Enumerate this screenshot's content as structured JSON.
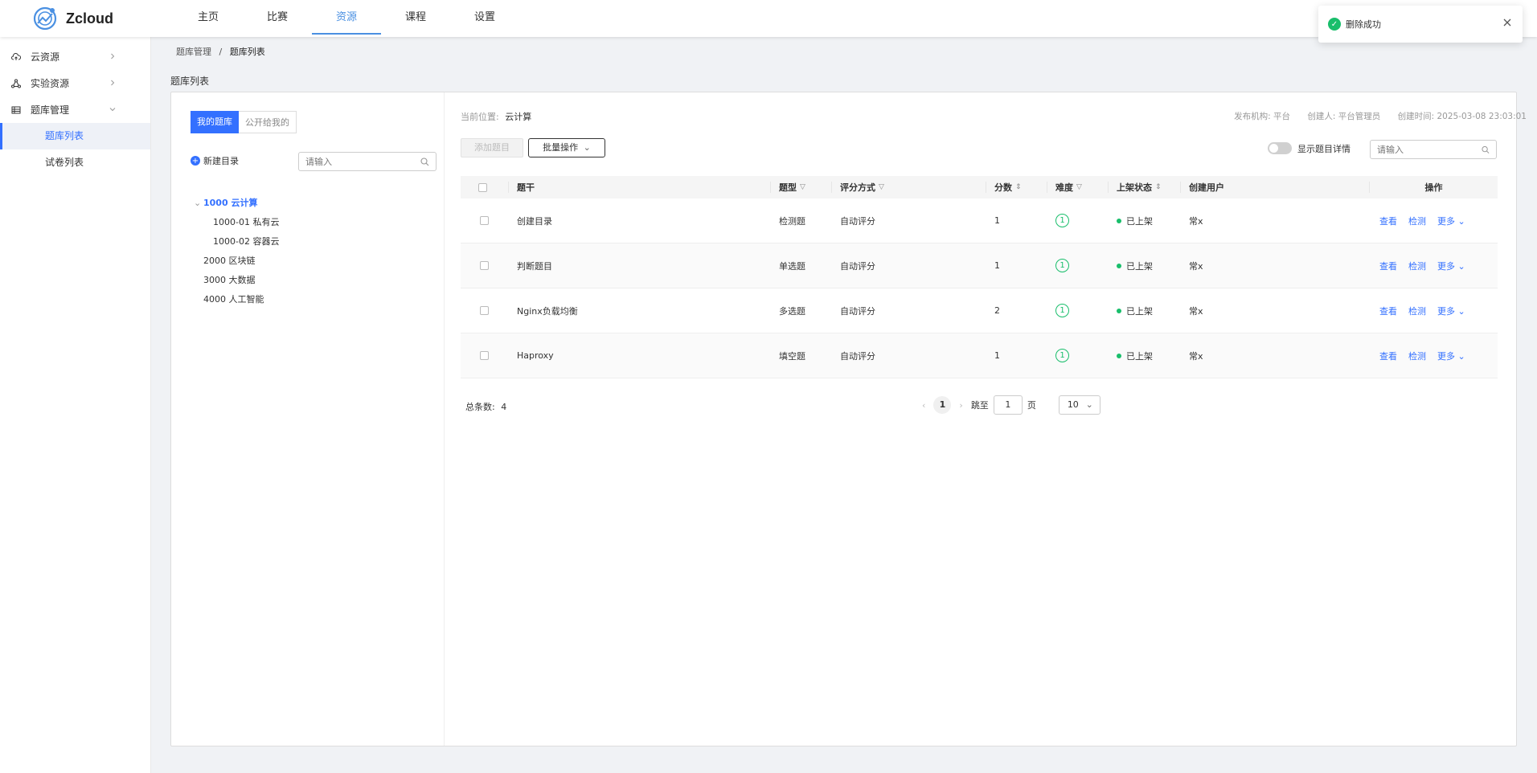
{
  "app": {
    "name": "Zcloud"
  },
  "nav": [
    "主页",
    "比赛",
    "资源",
    "课程",
    "设置"
  ],
  "sidebar": {
    "groups": [
      {
        "label": "云资源",
        "icon": "cloud-upload-icon"
      },
      {
        "label": "实验资源",
        "icon": "share-nodes-icon"
      },
      {
        "label": "题库管理",
        "icon": "list-table-icon"
      }
    ],
    "subs": [
      "题库列表",
      "试卷列表"
    ]
  },
  "breadcrumb": {
    "parent": "题库管理",
    "sep": "/",
    "current": "题库列表"
  },
  "page_title": "题库列表",
  "left": {
    "tab_mine": "我的题库",
    "tab_public": "公开给我的",
    "new_dir": "新建目录",
    "search_placeholder": "请输入",
    "tree": [
      "1000 云计算",
      "1000-01 私有云",
      "1000-02 容器云",
      "2000 区块链",
      "3000 大数据",
      "4000 人工智能"
    ]
  },
  "right": {
    "loc_label": "当前位置:",
    "loc_value": "云计算",
    "publisher": "发布机构: 平台",
    "creator": "创建人: 平台管理员",
    "created": "创建时间: 2025-03-08 23:03:01",
    "btn_add": "添加题目",
    "btn_batch": "批量操作",
    "toggle_label": "显示题目详情",
    "search_placeholder": "请输入"
  },
  "table": {
    "headers": [
      "题干",
      "题型",
      "评分方式",
      "分数",
      "难度",
      "上架状态",
      "创建用户",
      "操作"
    ],
    "rows": [
      {
        "stem": "创建目录",
        "type": "检测题",
        "scoring": "自动评分",
        "score": "1",
        "difficulty": "1",
        "status": "已上架",
        "user": "常x"
      },
      {
        "stem": "判断题目",
        "type": "单选题",
        "scoring": "自动评分",
        "score": "1",
        "difficulty": "1",
        "status": "已上架",
        "user": "常x"
      },
      {
        "stem": "Nginx负载均衡",
        "type": "多选题",
        "scoring": "自动评分",
        "score": "2",
        "difficulty": "1",
        "status": "已上架",
        "user": "常x"
      },
      {
        "stem": "Haproxy",
        "type": "填空题",
        "scoring": "自动评分",
        "score": "1",
        "difficulty": "1",
        "status": "已上架",
        "user": "常x"
      }
    ],
    "actions": [
      "查看",
      "检测",
      "更多"
    ]
  },
  "pager": {
    "total_label": "总条数:",
    "total": "4",
    "page": "1",
    "jump_label": "跳至",
    "jump_value": "1",
    "page_unit": "页",
    "page_size": "10"
  },
  "toast": {
    "message": "删除成功"
  },
  "colors": {
    "accent": "#3370ff",
    "success": "#19be6b",
    "nav_active": "#4a90e2"
  }
}
